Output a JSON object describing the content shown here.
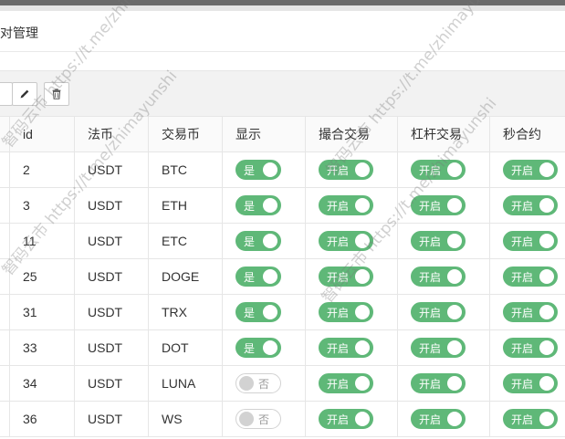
{
  "page": {
    "title": "对管理"
  },
  "toolbar": {
    "edit_icon": "pencil-icon",
    "delete_icon": "trash-icon"
  },
  "table": {
    "headers": [
      "id",
      "法币",
      "交易币",
      "显示",
      "撮合交易",
      "杠杆交易",
      "秒合约"
    ],
    "rows": [
      {
        "id": "2",
        "fiat": "USDT",
        "coin": "BTC",
        "show": "是",
        "show_on": true,
        "match": "开启",
        "leverage": "开启",
        "second": "开启"
      },
      {
        "id": "3",
        "fiat": "USDT",
        "coin": "ETH",
        "show": "是",
        "show_on": true,
        "match": "开启",
        "leverage": "开启",
        "second": "开启"
      },
      {
        "id": "11",
        "fiat": "USDT",
        "coin": "ETC",
        "show": "是",
        "show_on": true,
        "match": "开启",
        "leverage": "开启",
        "second": "开启"
      },
      {
        "id": "25",
        "fiat": "USDT",
        "coin": "DOGE",
        "show": "是",
        "show_on": true,
        "match": "开启",
        "leverage": "开启",
        "second": "开启"
      },
      {
        "id": "31",
        "fiat": "USDT",
        "coin": "TRX",
        "show": "是",
        "show_on": true,
        "match": "开启",
        "leverage": "开启",
        "second": "开启"
      },
      {
        "id": "33",
        "fiat": "USDT",
        "coin": "DOT",
        "show": "是",
        "show_on": true,
        "match": "开启",
        "leverage": "开启",
        "second": "开启"
      },
      {
        "id": "34",
        "fiat": "USDT",
        "coin": "LUNA",
        "show": "否",
        "show_on": false,
        "match": "开启",
        "leverage": "开启",
        "second": "开启"
      },
      {
        "id": "36",
        "fiat": "USDT",
        "coin": "WS",
        "show": "否",
        "show_on": false,
        "match": "开启",
        "leverage": "开启",
        "second": "开启"
      }
    ]
  },
  "watermarks": [
    "智码云市 https://t.me/zhimayunshi",
    "智码云市 https://t.me/zhimayunshi",
    "智码云市 https://t.me/zhimayunshi",
    "智码云市 https://t.me/zhimayunshi"
  ],
  "colors": {
    "switch_on": "#5fb878",
    "switch_off_border": "#d2d2d2"
  }
}
